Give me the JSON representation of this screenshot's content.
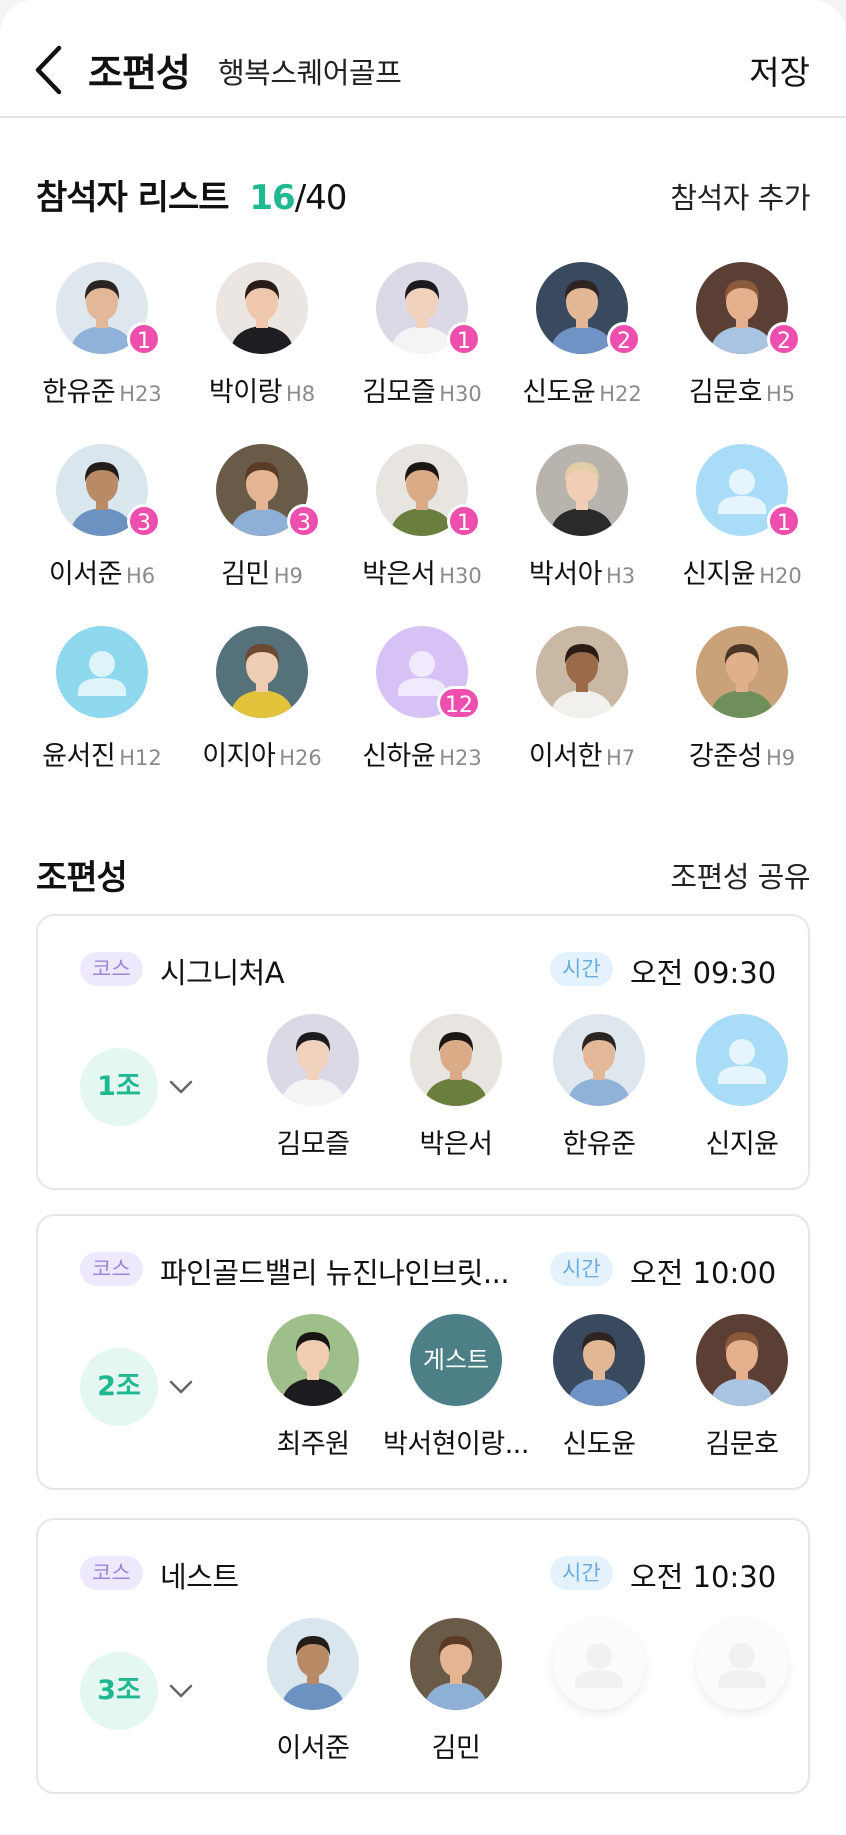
{
  "header": {
    "title": "조편성",
    "subtitle": "행복스퀘어골프",
    "save_label": "저장"
  },
  "participants": {
    "title": "참석자 리스트",
    "count_current": "16",
    "count_total": "/40",
    "add_label": "참석자 추가",
    "people": [
      {
        "name": "한유준",
        "code": "H23",
        "badge": "1",
        "avatar": {
          "kind": "photo",
          "bg": "#dfe7ee",
          "skin": "#e2b899",
          "hair": "#2b2420",
          "shirt": "#8fb3d8"
        }
      },
      {
        "name": "박이랑",
        "code": "H8",
        "badge": "",
        "avatar": {
          "kind": "photo",
          "bg": "#ece6e2",
          "skin": "#efc7ad",
          "hair": "#2a1d18",
          "shirt": "#1d1d22"
        }
      },
      {
        "name": "김모즐",
        "code": "H30",
        "badge": "1",
        "avatar": {
          "kind": "photo",
          "bg": "#dcd9e6",
          "skin": "#f1d3bd",
          "hair": "#1c1a1c",
          "shirt": "#f4f4f4"
        }
      },
      {
        "name": "신도윤",
        "code": "H22",
        "badge": "2",
        "avatar": {
          "kind": "photo",
          "bg": "#3a4a5e",
          "skin": "#e1b796",
          "hair": "#2d2320",
          "shirt": "#6f93c4"
        }
      },
      {
        "name": "김문호",
        "code": "H5",
        "badge": "2",
        "avatar": {
          "kind": "photo",
          "bg": "#5b3f34",
          "skin": "#e4b08e",
          "hair": "#8a5a3a",
          "shirt": "#a9c3e3"
        }
      },
      {
        "name": "이서준",
        "code": "H6",
        "badge": "3",
        "avatar": {
          "kind": "photo",
          "bg": "#d9e6ee",
          "skin": "#b98a66",
          "hair": "#241c18",
          "shirt": "#6c92c2"
        }
      },
      {
        "name": "김민",
        "code": "H9",
        "badge": "3",
        "avatar": {
          "kind": "photo",
          "bg": "#6a5a48",
          "skin": "#e3b592",
          "hair": "#5a3a24",
          "shirt": "#8fb0d6"
        }
      },
      {
        "name": "박은서",
        "code": "H30",
        "badge": "1",
        "avatar": {
          "kind": "photo",
          "bg": "#e8e4e0",
          "skin": "#d9ab87",
          "hair": "#1b1614",
          "shirt": "#6a7f3d"
        }
      },
      {
        "name": "박서아",
        "code": "H3",
        "badge": "",
        "avatar": {
          "kind": "photo",
          "bg": "#b9b3ae",
          "skin": "#f0cdb4",
          "hair": "#e3cfa6",
          "shirt": "#2a2a2a"
        }
      },
      {
        "name": "신지윤",
        "code": "H20",
        "badge": "1",
        "avatar": {
          "kind": "placeholder",
          "bg": "#a9dcf7",
          "fg": "#e6f5fd"
        }
      },
      {
        "name": "윤서진",
        "code": "H12",
        "badge": "",
        "avatar": {
          "kind": "placeholder",
          "bg": "#8fd9ee",
          "fg": "#def4fa"
        }
      },
      {
        "name": "이지아",
        "code": "H26",
        "badge": "",
        "avatar": {
          "kind": "photo",
          "bg": "#55727a",
          "skin": "#efcdb5",
          "hair": "#6a4a34",
          "shirt": "#e2c23a"
        }
      },
      {
        "name": "신하윤",
        "code": "H23",
        "badge": "12",
        "avatar": {
          "kind": "placeholder",
          "bg": "#d6c2f5",
          "fg": "#f1e9fc"
        }
      },
      {
        "name": "이서한",
        "code": "H7",
        "badge": "",
        "avatar": {
          "kind": "photo",
          "bg": "#c8b8a4",
          "skin": "#9b6a48",
          "hair": "#2a1c14",
          "shirt": "#f2f0ec"
        }
      },
      {
        "name": "강준성",
        "code": "H9",
        "badge": "",
        "avatar": {
          "kind": "photo",
          "bg": "#c9a27a",
          "skin": "#e0b08a",
          "hair": "#4a3424",
          "shirt": "#6f8f5a"
        }
      }
    ]
  },
  "groups_section": {
    "title": "조편성",
    "share_label": "조편성 공유",
    "course_tag": "코스",
    "time_tag": "시간",
    "groups": [
      {
        "label": "1조",
        "course": "시그니처A",
        "time": "오전 09:30",
        "members": [
          {
            "name": "김모즐",
            "ref": 2
          },
          {
            "name": "박은서",
            "ref": 7
          },
          {
            "name": "한유준",
            "ref": 0
          },
          {
            "name": "신지윤",
            "ref": 9
          }
        ]
      },
      {
        "label": "2조",
        "course": "파인골드밸리 뉴진나인브릿...",
        "time": "오전 10:00",
        "members": [
          {
            "name": "최주원",
            "avatar": {
              "kind": "photo",
              "bg": "#9fbf8a",
              "skin": "#f1cdb2",
              "hair": "#1a1514",
              "shirt": "#1b1b20"
            }
          },
          {
            "name": "박서현이랑...",
            "guest": "게스트"
          },
          {
            "name": "신도윤",
            "ref": 3
          },
          {
            "name": "김문호",
            "ref": 4
          }
        ]
      },
      {
        "label": "3조",
        "course": "네스트",
        "time": "오전 10:30",
        "members": [
          {
            "name": "이서준",
            "ref": 5
          },
          {
            "name": "김민",
            "ref": 6
          },
          {
            "empty": true
          },
          {
            "empty": true
          }
        ]
      }
    ]
  },
  "colors": {
    "accent_green": "#1fb890",
    "badge_pink": "#ee4fae",
    "course_tag_bg": "#ede8fb",
    "time_tag_bg": "#e3f2fc"
  }
}
